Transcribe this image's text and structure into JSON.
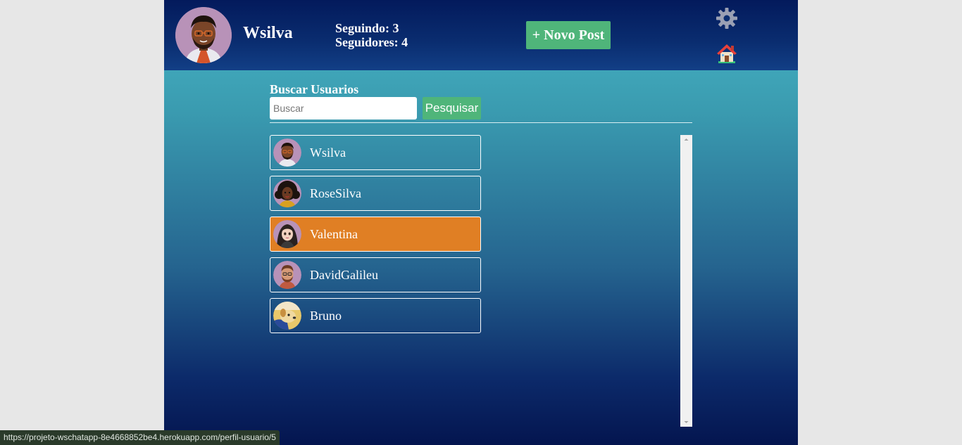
{
  "header": {
    "username": "Wsilva",
    "following": "Seguindo: 3",
    "followers": "Seguidores: 4",
    "new_post_label": "+ Novo Post",
    "settings_icon": "gear-icon",
    "home_icon": "home-icon"
  },
  "search": {
    "title": "Buscar Usuarios",
    "placeholder": "Buscar",
    "button_label": "Pesquisar"
  },
  "users": [
    {
      "name": "Wsilva",
      "active": false
    },
    {
      "name": "RoseSilva",
      "active": false
    },
    {
      "name": "Valentina",
      "active": true
    },
    {
      "name": "DavidGalileu",
      "active": false
    },
    {
      "name": "Bruno",
      "active": false
    }
  ],
  "status_bar": {
    "url": "https://projeto-wschatapp-8e4668852be4.herokuapp.com/perfil-usuario/5"
  },
  "colors": {
    "header_bg": "#031a5c",
    "accent_green": "#4fb57a",
    "active_item": "#e07f24"
  }
}
